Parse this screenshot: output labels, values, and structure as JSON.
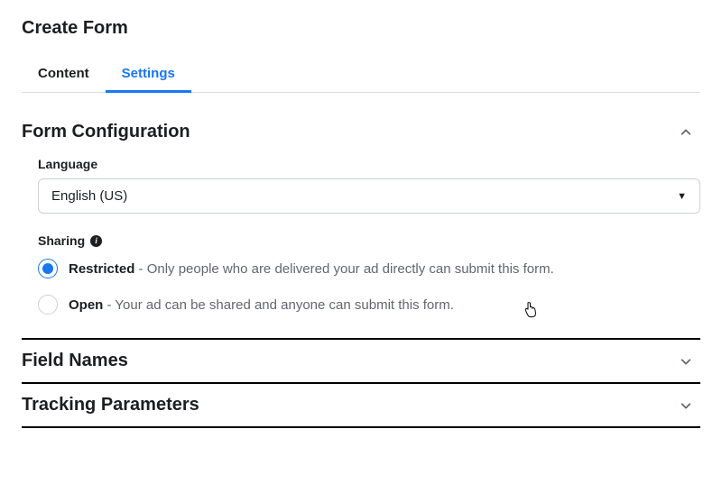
{
  "header": {
    "title": "Create Form"
  },
  "tabs": {
    "content": {
      "label": "Content",
      "active": false
    },
    "settings": {
      "label": "Settings",
      "active": true
    }
  },
  "sections": {
    "form_configuration": {
      "title": "Form Configuration",
      "expanded": true,
      "language": {
        "label": "Language",
        "selected": "English (US)"
      },
      "sharing": {
        "label": "Sharing",
        "options": {
          "restricted": {
            "title": "Restricted",
            "description": " - Only people who are delivered your ad directly can submit this form.",
            "selected": true
          },
          "open": {
            "title": "Open",
            "description": " - Your ad can be shared and anyone can submit this form.",
            "selected": false
          }
        }
      }
    },
    "field_names": {
      "title": "Field Names",
      "expanded": false
    },
    "tracking_parameters": {
      "title": "Tracking Parameters",
      "expanded": false
    }
  }
}
